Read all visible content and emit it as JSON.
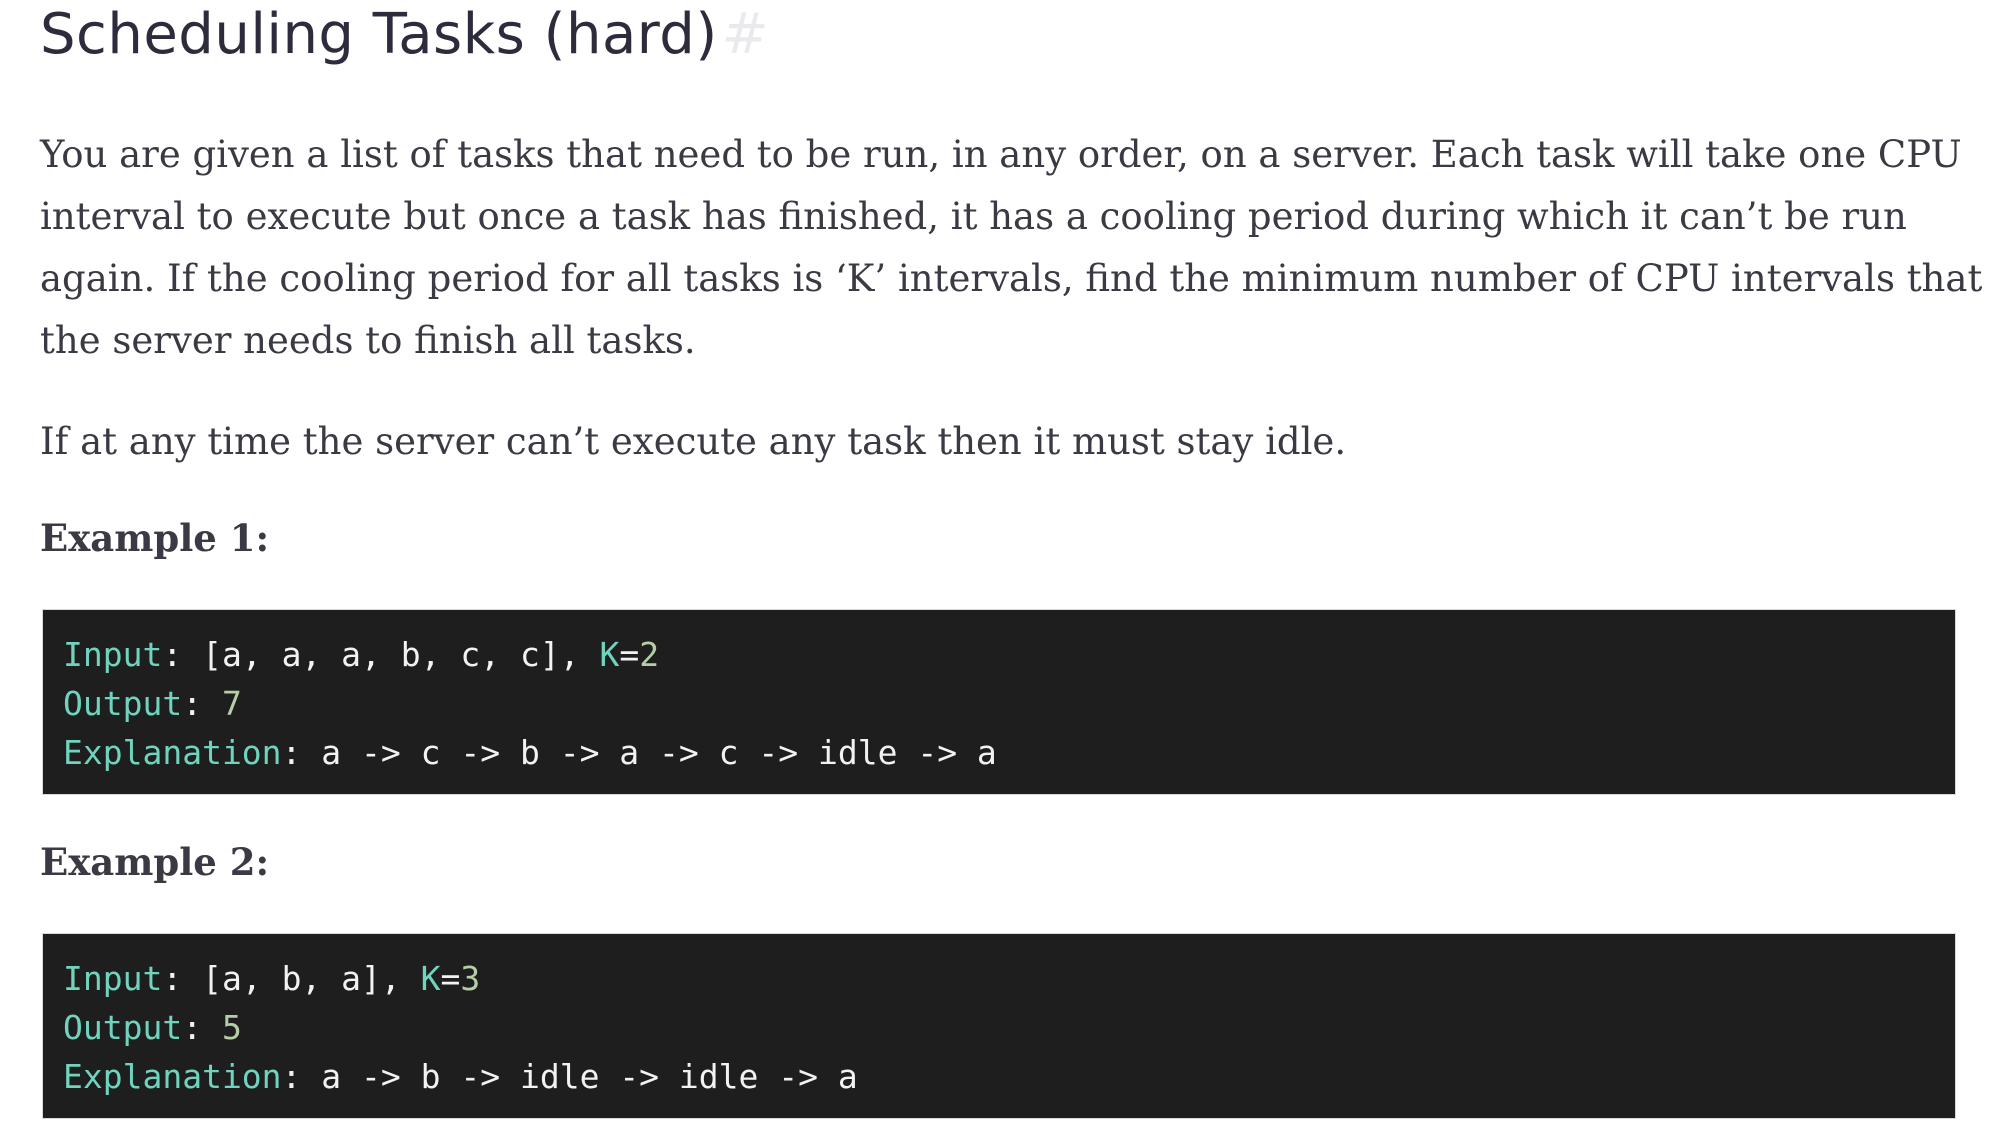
{
  "title": "Scheduling Tasks (hard)",
  "title_anchor": "#",
  "paragraphs": [
    "You are given a list of tasks that need to be run, in any order, on a server. Each task will take one CPU interval to execute but once a task has finished, it has a cooling period during which it can’t be run again. If the cooling period for all tasks is ‘K’ intervals, find the minimum number of CPU intervals that the server needs to finish all tasks.",
    "If at any time the server can’t execute any task then it must stay idle."
  ],
  "examples": [
    {
      "label": "Example 1:",
      "input_keyword": "Input",
      "input_value": "[a, a, a, b, c, c]",
      "k_keyword": "K",
      "k_value": "2",
      "output_keyword": "Output",
      "output_value": "7",
      "explanation_keyword": "Explanation",
      "explanation_value": "a -> c -> b -> a -> c -> idle -> a"
    },
    {
      "label": "Example 2:",
      "input_keyword": "Input",
      "input_value": "[a, b, a]",
      "k_keyword": "K",
      "k_value": "3",
      "output_keyword": "Output",
      "output_value": "5",
      "explanation_keyword": "Explanation",
      "explanation_value": "a -> b -> idle -> idle -> a"
    }
  ]
}
